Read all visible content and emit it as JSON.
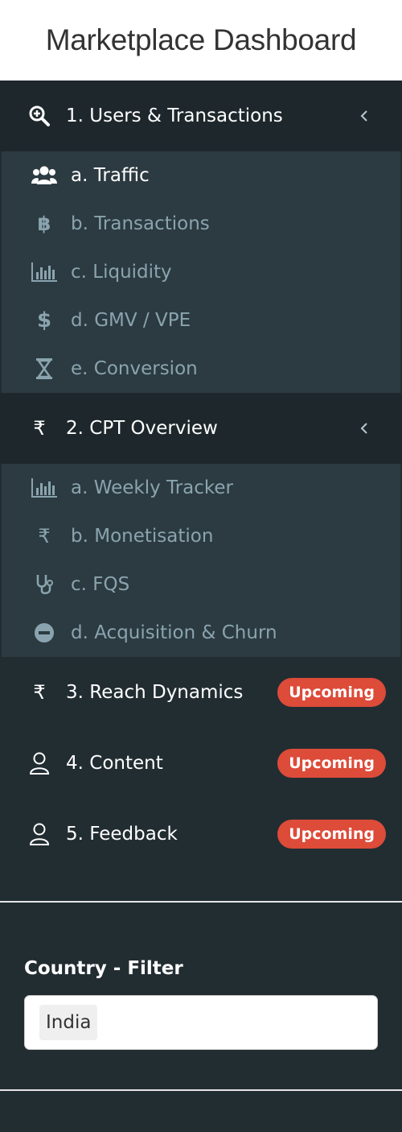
{
  "header": {
    "title": "Marketplace Dashboard"
  },
  "sidebar": {
    "sections": [
      {
        "label": "1. Users & Transactions",
        "icon": "search-plus-icon",
        "expanded": true,
        "items": [
          {
            "label": "a. Traffic",
            "icon": "users-icon",
            "active": true
          },
          {
            "label": "b. Transactions",
            "icon": "bitcoin-icon"
          },
          {
            "label": "c. Liquidity",
            "icon": "bar-chart-icon"
          },
          {
            "label": "d. GMV / VPE",
            "icon": "dollar-icon"
          },
          {
            "label": "e. Conversion",
            "icon": "hourglass-icon"
          }
        ]
      },
      {
        "label": "2. CPT Overview",
        "icon": "rupee-icon",
        "expanded": true,
        "items": [
          {
            "label": "a. Weekly Tracker",
            "icon": "bar-chart-icon"
          },
          {
            "label": "b. Monetisation",
            "icon": "rupee-icon"
          },
          {
            "label": "c. FQS",
            "icon": "stethoscope-icon"
          },
          {
            "label": "d. Acquisition & Churn",
            "icon": "minus-circle-icon"
          }
        ]
      },
      {
        "label": "3. Reach Dynamics",
        "icon": "rupee-icon",
        "badge": "Upcoming"
      },
      {
        "label": "4. Content",
        "icon": "user-icon",
        "badge": "Upcoming"
      },
      {
        "label": "5. Feedback",
        "icon": "user-icon",
        "badge": "Upcoming"
      }
    ]
  },
  "filter": {
    "label": "Country - Filter",
    "selected": "India"
  },
  "colors": {
    "sidebar_bg": "#222d32",
    "active_bg": "#1e282c",
    "submenu_bg": "#2c3b41",
    "badge_red": "#dd4b39",
    "submenu_text": "#8aa4af"
  }
}
